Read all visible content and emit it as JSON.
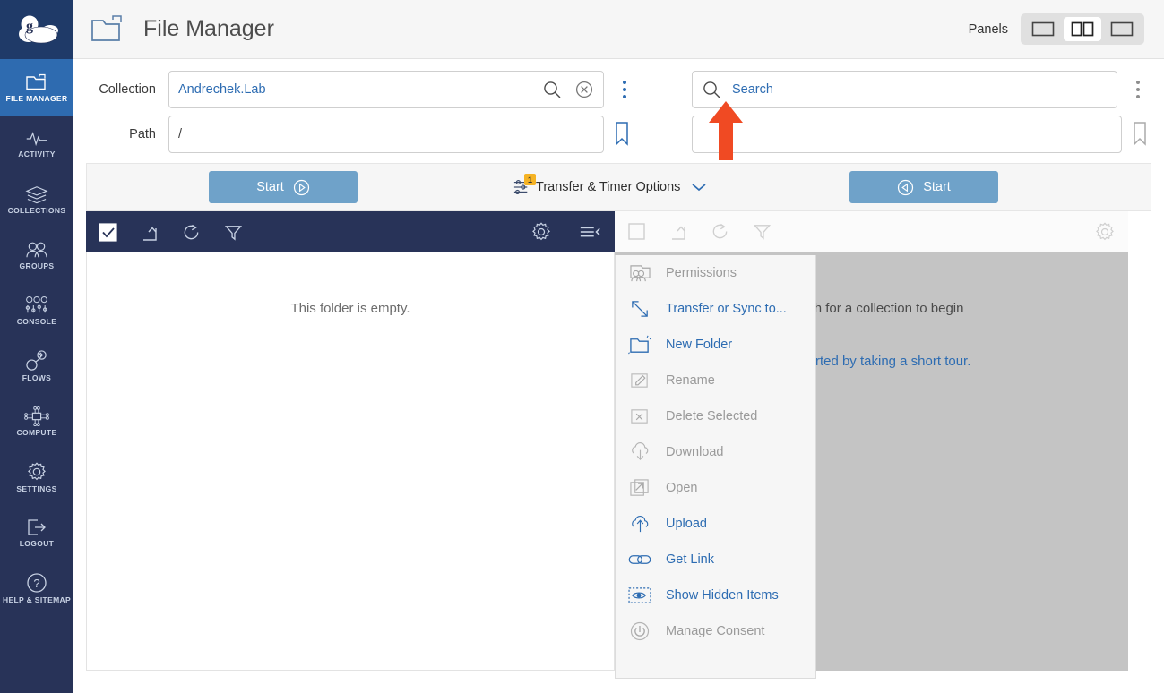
{
  "header": {
    "title": "File Manager",
    "folder_icon": "folder-icon",
    "panels_label": "Panels",
    "panel_buttons": [
      {
        "name": "single-panel-left",
        "selected": false
      },
      {
        "name": "dual-panel",
        "selected": true
      },
      {
        "name": "single-panel-right",
        "selected": false
      }
    ]
  },
  "sidebar": {
    "logo": "globus-cloud-logo",
    "items": [
      {
        "label": "FILE MANAGER",
        "icon": "folder-icon",
        "active": true
      },
      {
        "label": "ACTIVITY",
        "icon": "activity-pulse-icon",
        "active": false
      },
      {
        "label": "COLLECTIONS",
        "icon": "layers-icon",
        "active": false
      },
      {
        "label": "GROUPS",
        "icon": "people-icon",
        "active": false
      },
      {
        "label": "CONSOLE",
        "icon": "sliders-icon",
        "active": false
      },
      {
        "label": "FLOWS",
        "icon": "flow-nodes-icon",
        "active": false
      },
      {
        "label": "COMPUTE",
        "icon": "compute-network-icon",
        "active": false
      },
      {
        "label": "SETTINGS",
        "icon": "gear-icon",
        "active": false
      },
      {
        "label": "LOGOUT",
        "icon": "logout-arrow-icon",
        "active": false
      },
      {
        "label": "HELP & SITEMAP",
        "icon": "question-circle-icon",
        "active": false
      }
    ]
  },
  "left_form": {
    "collection_label": "Collection",
    "collection_value": "Andrechek.Lab",
    "collection_search_icon": "search-icon",
    "collection_clear_icon": "clear-circle-x-icon",
    "path_label": "Path",
    "path_value": "/",
    "kebab_icon": "overflow-menu-icon",
    "bookmark_icon": "bookmark-icon"
  },
  "right_form": {
    "search_placeholder": "Search",
    "search_icon": "search-icon",
    "search_value": "",
    "second_value": "",
    "kebab_icon": "overflow-menu-icon",
    "bookmark_icon": "bookmark-icon"
  },
  "action_bar": {
    "start_left_label": "Start",
    "start_left_icon": "play-right-circle-icon",
    "start_right_label": "Start",
    "start_right_icon": "play-left-circle-icon",
    "transfer_options_label": "Transfer & Timer Options",
    "transfer_options_icon": "sliders-icon",
    "transfer_options_badge": "1",
    "transfer_options_chevron": "chevron-down-icon"
  },
  "left_pane": {
    "toolbar": [
      {
        "name": "select-all-checkbox",
        "icon": "checkbox-checked-icon"
      },
      {
        "name": "up-one-folder-button",
        "icon": "arrow-up-left-icon"
      },
      {
        "name": "refresh-button",
        "icon": "refresh-icon"
      },
      {
        "name": "filter-button",
        "icon": "funnel-icon"
      }
    ],
    "toolbar_right": [
      {
        "name": "pane-settings-button",
        "icon": "gear-icon"
      },
      {
        "name": "pane-menu-toggle",
        "icon": "hamburger-collapse-icon"
      }
    ],
    "empty_message": "This folder is empty."
  },
  "right_pane": {
    "toolbar": [
      {
        "name": "select-all-checkbox",
        "icon": "checkbox-empty-icon"
      },
      {
        "name": "up-one-folder-button",
        "icon": "arrow-up-left-icon"
      },
      {
        "name": "refresh-button",
        "icon": "refresh-icon"
      },
      {
        "name": "filter-button",
        "icon": "funnel-icon"
      }
    ],
    "toolbar_right": [
      {
        "name": "pane-settings-button",
        "icon": "gear-icon"
      }
    ],
    "hint_line": "Search for a collection to begin",
    "tour_link": "Get started by taking a short tour."
  },
  "menu": {
    "items": [
      {
        "label": "Permissions",
        "icon": "permissions-people-icon",
        "enabled": false
      },
      {
        "label": "Transfer or Sync to...",
        "icon": "transfer-diagonal-arrows-icon",
        "enabled": true
      },
      {
        "label": "New Folder",
        "icon": "new-folder-icon",
        "enabled": true
      },
      {
        "label": "Rename",
        "icon": "rename-pencil-icon",
        "enabled": false
      },
      {
        "label": "Delete Selected",
        "icon": "delete-x-icon",
        "enabled": false
      },
      {
        "label": "Download",
        "icon": "download-cloud-icon",
        "enabled": false
      },
      {
        "label": "Open",
        "icon": "open-external-icon",
        "enabled": false
      },
      {
        "label": "Upload",
        "icon": "upload-cloud-icon",
        "enabled": true
      },
      {
        "label": "Get Link",
        "icon": "link-chain-icon",
        "enabled": true
      },
      {
        "label": "Show Hidden Items",
        "icon": "eye-hidden-icon",
        "enabled": true
      },
      {
        "label": "Manage Consent",
        "icon": "power-circle-icon",
        "enabled": false
      }
    ]
  },
  "annotation": {
    "arrow": "red-up-arrow-pointer"
  },
  "colors": {
    "rail_bg": "#283358",
    "rail_active": "#2e6bb0",
    "accent_blue": "#2d6cb2",
    "button_blue": "#6fa2c9",
    "badge_yellow": "#f5b324",
    "arrow_red": "#f04a23",
    "right_pane_gray": "#c4c4c4"
  }
}
